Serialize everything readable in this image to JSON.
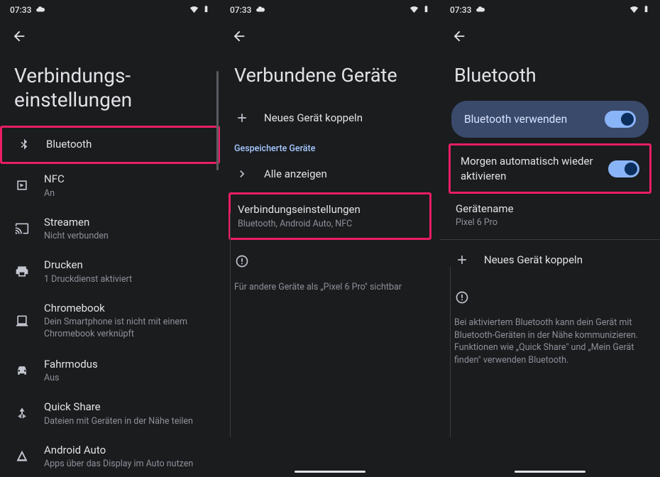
{
  "status": {
    "time": "07:33"
  },
  "screen1": {
    "title": "Verbindungs­einstellungen",
    "items": [
      {
        "title": "Bluetooth",
        "sub": ""
      },
      {
        "title": "NFC",
        "sub": "An"
      },
      {
        "title": "Streamen",
        "sub": "Nicht verbunden"
      },
      {
        "title": "Drucken",
        "sub": "1 Druckdienst aktiviert"
      },
      {
        "title": "Chromebook",
        "sub": "Dein Smartphone ist nicht mit einem Chromebook verknüpft"
      },
      {
        "title": "Fahrmodus",
        "sub": "Aus"
      },
      {
        "title": "Quick Share",
        "sub": "Dateien mit Geräten in der Nähe teilen"
      },
      {
        "title": "Android Auto",
        "sub": "Apps über das Display im Auto nutzen"
      }
    ]
  },
  "screen2": {
    "title": "Verbundene Geräte",
    "pair": "Neues Gerät koppeln",
    "saved_label": "Gespeicherte Geräte",
    "show_all": "Alle anzeigen",
    "prefs_title": "Verbindungseinstellungen",
    "prefs_sub": "Bluetooth, Android Auto, NFC",
    "visible": "Für andere Geräte als „Pixel 6 Pro\" sichtbar"
  },
  "screen3": {
    "title": "Bluetooth",
    "use_bt": "Bluetooth verwenden",
    "auto_on": "Morgen automatisch wieder aktivieren",
    "device_name_label": "Gerätename",
    "device_name_value": "Pixel 6 Pro",
    "pair": "Neues Gerät koppeln",
    "info": "Bei aktiviertem Bluetooth kann dein Gerät mit Bluetooth-Geräten in der Nähe kommunizieren. Funktionen wie „Quick Share\" und „Mein Gerät finden\" verwenden Bluetooth."
  }
}
